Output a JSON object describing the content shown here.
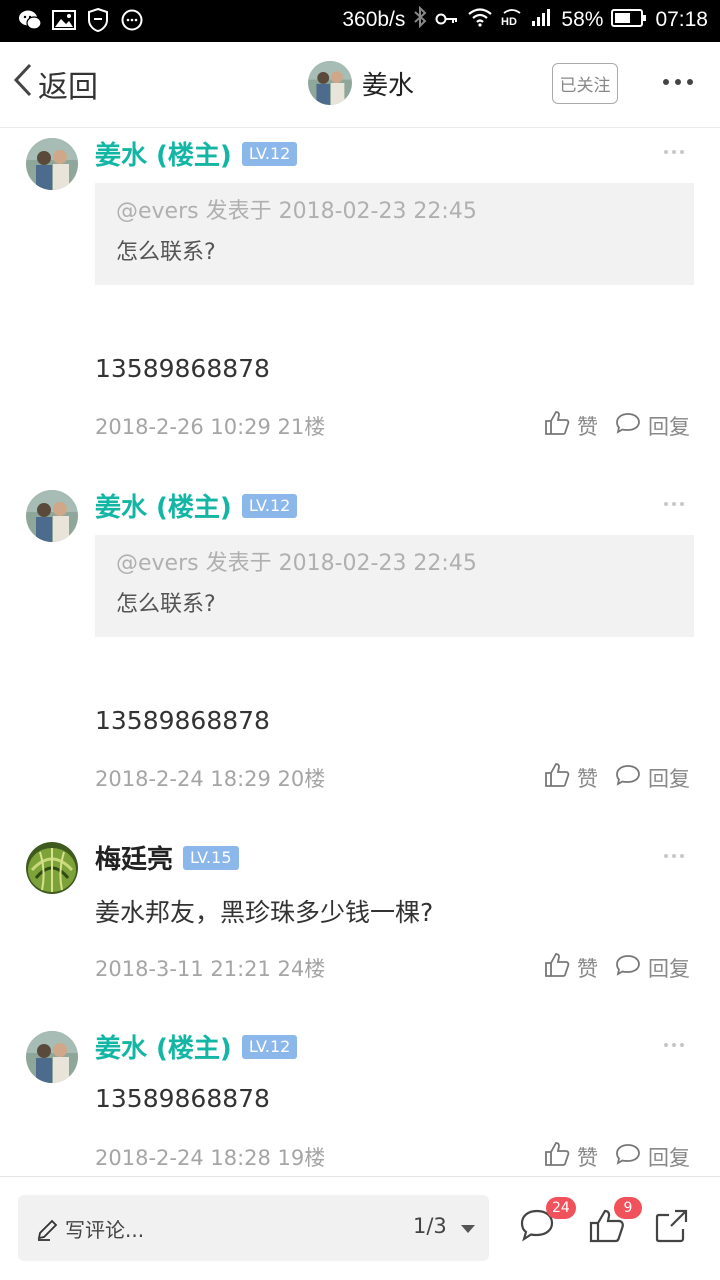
{
  "status_bar": {
    "net_speed": "360b/s",
    "battery": "58%",
    "time": "07:18",
    "icons": [
      "wechat-icon",
      "gallery-icon",
      "shield-icon",
      "message-icon",
      "bluetooth-icon",
      "key-icon",
      "wifi-icon",
      "hd-icon",
      "signal-icon",
      "battery-icon"
    ]
  },
  "header": {
    "back_label": "返回",
    "title": "姜水",
    "follow_label": "已关注"
  },
  "posts": [
    {
      "author": "姜水 (楼主)",
      "level": "LV.12",
      "quote_meta": "@evers 发表于 2018-02-23 22:45",
      "quote_text": "怎么联系?",
      "content": "13589868878",
      "time": "2018-2-26 10:29  21楼",
      "like_label": "赞",
      "reply_label": "回复"
    },
    {
      "author": "姜水 (楼主)",
      "level": "LV.12",
      "quote_meta": "@evers 发表于 2018-02-23 22:45",
      "quote_text": "怎么联系?",
      "content": "13589868878",
      "time": "2018-2-24 18:29  20楼",
      "like_label": "赞",
      "reply_label": "回复"
    },
    {
      "author": "梅廷亮",
      "level": "LV.15",
      "content": "姜水邦友，黑珍珠多少钱一棵?",
      "time": "2018-3-11 21:21  24楼",
      "like_label": "赞",
      "reply_label": "回复"
    },
    {
      "author": "姜水 (楼主)",
      "level": "LV.12",
      "content": "13589868878",
      "time": "2018-2-24 18:28  19楼",
      "like_label": "赞",
      "reply_label": "回复"
    }
  ],
  "bottom_bar": {
    "comment_placeholder": "写评论...",
    "page_indicator": "1/3",
    "comments_count": "24",
    "likes_count": "9"
  },
  "colors": {
    "accent_teal": "#13b6a4",
    "level_badge": "#8cb7ea",
    "notification_red": "#f1515b"
  }
}
